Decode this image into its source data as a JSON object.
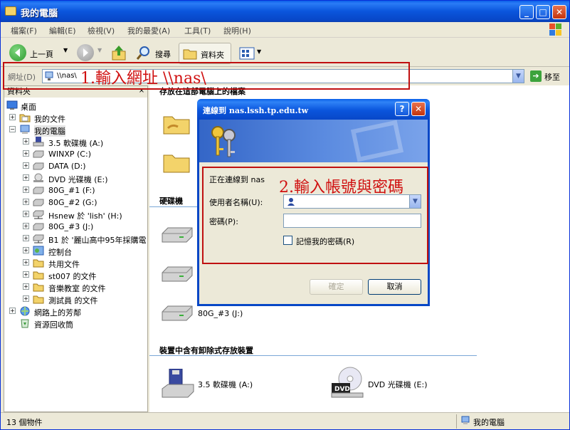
{
  "window": {
    "title": "我的電腦",
    "minimize": "_",
    "maximize": "□",
    "close": "✕"
  },
  "menu": [
    "檔案(F)",
    "編輯(E)",
    "檢視(V)",
    "我的最愛(A)",
    "工具(T)",
    "說明(H)"
  ],
  "toolbar": {
    "back": "上一頁",
    "search": "搜尋",
    "folders": "資料夾"
  },
  "address": {
    "label": "網址(D)",
    "value": "\\\\nas\\",
    "go": "移至"
  },
  "annotations": {
    "step1": "1.輸入網址 \\\\nas\\",
    "step2": "2.輸入帳號與密碼"
  },
  "left_panel": {
    "title": "資料夾",
    "close": "×",
    "tree": [
      {
        "label": "桌面",
        "icon": "desktop-icon"
      },
      {
        "label": "我的文件",
        "icon": "my-documents-icon"
      },
      {
        "label": "我的電腦",
        "icon": "my-computer-icon"
      },
      {
        "label": "3.5 軟碟機 (A:)",
        "icon": "floppy-icon"
      },
      {
        "label": "WINXP (C:)",
        "icon": "hard-drive-icon"
      },
      {
        "label": "DATA (D:)",
        "icon": "hard-drive-icon"
      },
      {
        "label": "DVD 光碟機 (E:)",
        "icon": "dvd-drive-icon"
      },
      {
        "label": "80G_#1 (F:)",
        "icon": "hard-drive-icon"
      },
      {
        "label": "80G_#2 (G:)",
        "icon": "hard-drive-icon"
      },
      {
        "label": "Hsnew 於 'lish' (H:)",
        "icon": "network-drive-icon"
      },
      {
        "label": "80G_#3 (J:)",
        "icon": "hard-drive-icon"
      },
      {
        "label": "B1 於 '麗山高中95年採購電",
        "icon": "network-drive-icon"
      },
      {
        "label": "控制台",
        "icon": "control-panel-icon"
      },
      {
        "label": "共用文件",
        "icon": "folder-icon"
      },
      {
        "label": "st007 的文件",
        "icon": "folder-icon"
      },
      {
        "label": "音樂教室 的文件",
        "icon": "folder-icon"
      },
      {
        "label": "測試員 的文件",
        "icon": "folder-icon"
      },
      {
        "label": "網路上的芳鄰",
        "icon": "network-places-icon"
      },
      {
        "label": "資源回收筒",
        "icon": "recycle-bin-icon"
      }
    ]
  },
  "content": {
    "section_files": "存放在這部電腦上的檔案",
    "section_hdd": "硬碟機",
    "section_removable": "裝置中含有卸除式存放裝置",
    "drive_j": "80G_#3 (J:)",
    "floppy": "3.5 軟碟機 (A:)",
    "dvd": "DVD 光碟機 (E:)"
  },
  "status": {
    "count": "13 個物件",
    "location": "我的電腦"
  },
  "dialog": {
    "title": "連線到 nas.lssh.tp.edu.tw",
    "help": "?",
    "close": "✕",
    "connecting": "正在連線到 nas",
    "username_label": "使用者名稱(U):",
    "username_value": "",
    "password_label": "密碼(P):",
    "password_value": "",
    "remember": "記憶我的密碼(R)",
    "ok": "確定",
    "cancel": "取消"
  }
}
